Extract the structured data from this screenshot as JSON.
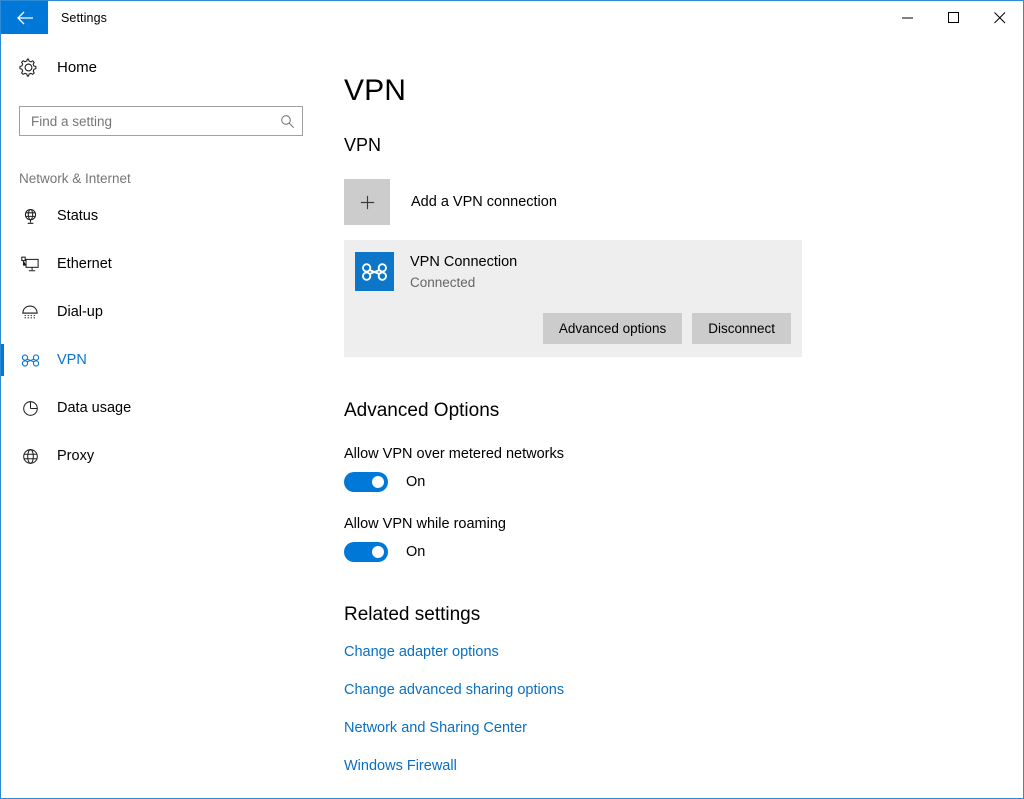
{
  "window": {
    "title": "Settings",
    "back_icon": "back-arrow-icon",
    "caption": {
      "minimize": "minimize-icon",
      "maximize": "maximize-icon",
      "close": "close-icon"
    },
    "border_color": "#2c8bd4",
    "accent_color": "#0078d7"
  },
  "sidebar": {
    "home": {
      "label": "Home",
      "icon": "gear-icon"
    },
    "search": {
      "value": "",
      "placeholder": "Find a setting",
      "icon": "search-icon"
    },
    "category": "Network & Internet",
    "items": [
      {
        "label": "Status",
        "icon": "globe-stand-icon",
        "active": false
      },
      {
        "label": "Ethernet",
        "icon": "monitor-icon",
        "active": false
      },
      {
        "label": "Dial-up",
        "icon": "modem-icon",
        "active": false
      },
      {
        "label": "VPN",
        "icon": "vpn-knot-icon",
        "active": true
      },
      {
        "label": "Data usage",
        "icon": "pie-chart-icon",
        "active": false
      },
      {
        "label": "Proxy",
        "icon": "globe-icon",
        "active": false
      }
    ]
  },
  "main": {
    "page_title": "VPN",
    "group_title": "VPN",
    "add_connection": {
      "label": "Add a VPN connection",
      "icon": "plus-icon"
    },
    "connection": {
      "icon": "vpn-knot-icon",
      "name": "VPN Connection",
      "status": "Connected",
      "buttons": {
        "advanced": "Advanced options",
        "disconnect": "Disconnect"
      }
    },
    "advanced": {
      "title": "Advanced Options",
      "options": [
        {
          "label": "Allow VPN over metered networks",
          "state": "On",
          "on": true
        },
        {
          "label": "Allow VPN while roaming",
          "state": "On",
          "on": true
        }
      ]
    },
    "related": {
      "title": "Related settings",
      "links": [
        "Change adapter options",
        "Change advanced sharing options",
        "Network and Sharing Center",
        "Windows Firewall"
      ]
    }
  }
}
